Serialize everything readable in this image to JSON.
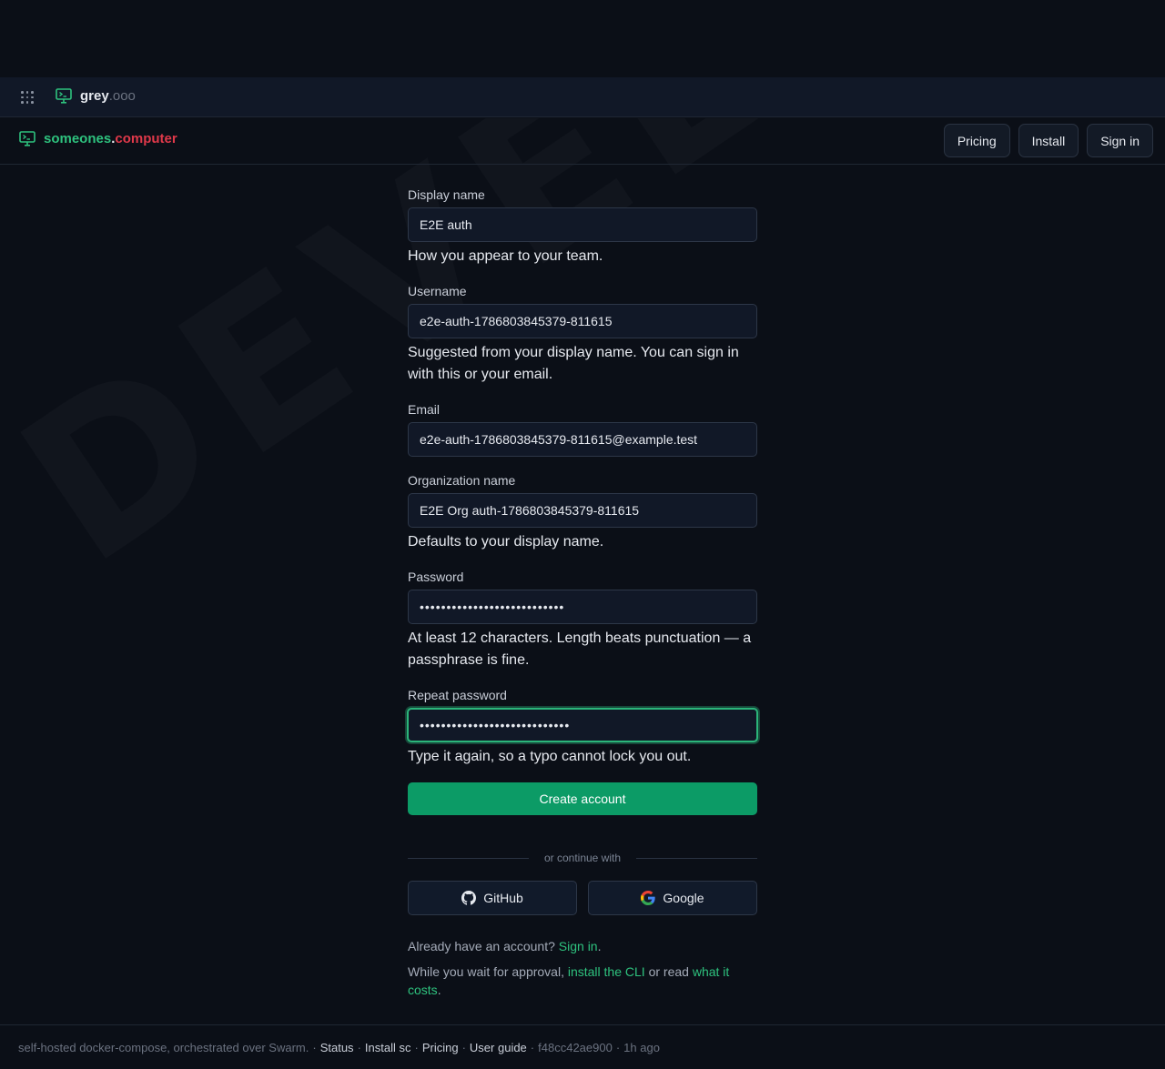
{
  "watermark": "DEVELOPMENT",
  "topbar": {
    "brand_name": "grey",
    "brand_suffix": ".ooo"
  },
  "header": {
    "brand_part1": "someones",
    "brand_dot": ".",
    "brand_part2": "computer",
    "nav": [
      "Pricing",
      "Install",
      "Sign in"
    ]
  },
  "form": {
    "display_name": {
      "label": "Display name",
      "value": "E2E auth",
      "hint": "How you appear to your team."
    },
    "username": {
      "label": "Username",
      "value": "e2e-auth-1786803845379-811615",
      "hint": "Suggested from your display name. You can sign in with this or your email."
    },
    "email": {
      "label": "Email",
      "value": "e2e-auth-1786803845379-811615@example.test"
    },
    "org_name": {
      "label": "Organization name",
      "value": "E2E Org auth-1786803845379-811615",
      "hint": "Defaults to your display name."
    },
    "password": {
      "label": "Password",
      "value": "•••••••••••••••••••••••••••",
      "hint": "At least 12 characters. Length beats punctuation — a passphrase is fine."
    },
    "repeat_password": {
      "label": "Repeat password",
      "value": "••••••••••••••••••••••••••••",
      "hint": "Type it again, so a typo cannot lock you out."
    },
    "submit_label": "Create account",
    "divider_text": "or continue with",
    "github_label": "GitHub",
    "google_label": "Google",
    "signin_prompt": "Already have an account?",
    "signin_link": "Sign in",
    "approval_prefix": "While you wait for approval,",
    "install_link": "install the CLI",
    "approval_mid": "or read",
    "costs_link": "what it costs"
  },
  "footer": {
    "text": "self-hosted docker-compose, orchestrated over Swarm.",
    "links": [
      "Status",
      "Install sc",
      "Pricing",
      "User guide"
    ],
    "commit": "f48cc42ae900",
    "age": "1h ago"
  },
  "colors": {
    "background": "#0b0f17",
    "accent": "#2ec27e",
    "brand_red": "#e0394a",
    "primary_button": "#0c9b66"
  }
}
